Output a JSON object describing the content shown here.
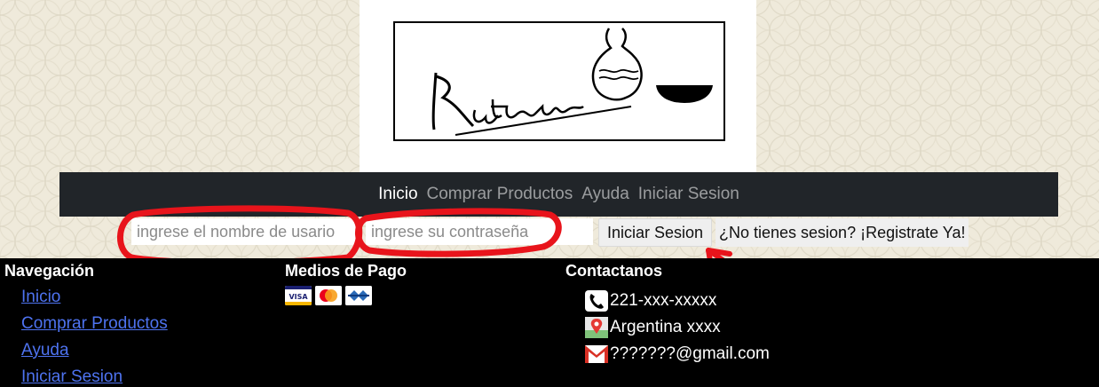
{
  "logo": {
    "brand_text": "Kutun",
    "name": "logo"
  },
  "nav": {
    "items": [
      {
        "label": "Inicio",
        "active": true
      },
      {
        "label": "Comprar Productos",
        "active": false
      },
      {
        "label": "Ayuda",
        "active": false
      },
      {
        "label": "Iniciar Sesion",
        "active": false
      }
    ]
  },
  "login": {
    "username_placeholder": "ingrese el nombre de usario",
    "password_placeholder": "ingrese su contraseña",
    "submit_label": "Iniciar Sesion",
    "register_label": "¿No tienes sesion? ¡Registrate Ya!"
  },
  "footer": {
    "nav_title": "Navegación",
    "nav_links": [
      "Inicio",
      "Comprar Productos",
      "Ayuda",
      "Iniciar Sesion"
    ],
    "payment_title": "Medios de Pago",
    "payment_icons": [
      "visa-card-icon",
      "mastercard-icon",
      "cabal-card-icon"
    ],
    "contact_title": "Contactanos",
    "contacts": [
      {
        "icon": "phone-icon",
        "text": "221-xxx-xxxxx"
      },
      {
        "icon": "map-pin-icon",
        "text": "Argentina xxxx"
      },
      {
        "icon": "gmail-icon",
        "text": "???????@gmail.com"
      }
    ]
  },
  "colors": {
    "navbar_bg": "#212529",
    "footer_bg": "#000000",
    "link": "#4e73f0",
    "annotation": "#e8141b"
  }
}
